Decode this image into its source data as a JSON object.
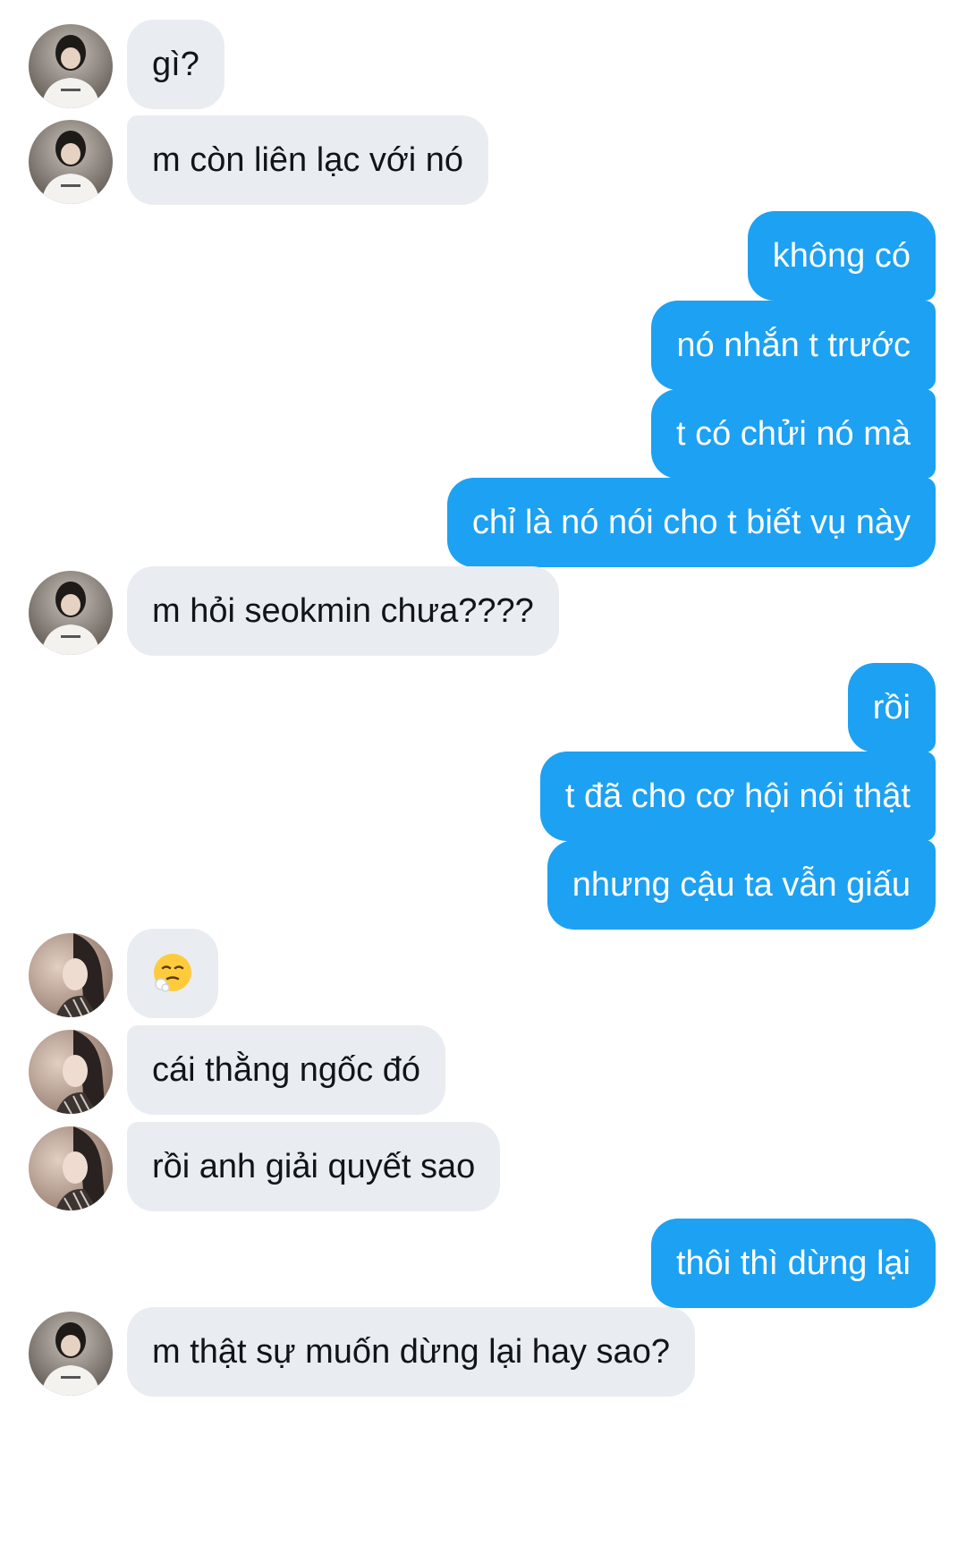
{
  "conversation": {
    "messages": [
      {
        "from": "them",
        "avatar": "avatar-a",
        "text": "gì?"
      },
      {
        "from": "them",
        "avatar": "avatar-a",
        "text": "m còn liên lạc với nó"
      },
      {
        "from": "me",
        "text": "không có"
      },
      {
        "from": "me",
        "text": "nó nhắn t trước"
      },
      {
        "from": "me",
        "text": "t có chửi nó mà"
      },
      {
        "from": "me",
        "text": "chỉ là nó nói cho t biết vụ này"
      },
      {
        "from": "them",
        "avatar": "avatar-a",
        "text": "m hỏi seokmin chưa????"
      },
      {
        "from": "me",
        "text": "rồi"
      },
      {
        "from": "me",
        "text": "t đã cho cơ hội nói thật"
      },
      {
        "from": "me",
        "text": "nhưng cậu ta vẫn giấu"
      },
      {
        "from": "them",
        "avatar": "avatar-b",
        "emoji": "tired-face-emoji"
      },
      {
        "from": "them",
        "avatar": "avatar-b",
        "text": "cái thằng ngốc đó"
      },
      {
        "from": "them",
        "avatar": "avatar-b",
        "text": "rồi anh giải quyết sao"
      },
      {
        "from": "me",
        "text": "thôi thì dừng lại"
      },
      {
        "from": "them",
        "avatar": "avatar-a",
        "text": "m thật sự muốn dừng lại hay sao?"
      }
    ]
  },
  "colors": {
    "outgoing_bubble": "#1da1f2",
    "incoming_bubble": "#e9edf1",
    "background": "#ffffff"
  }
}
